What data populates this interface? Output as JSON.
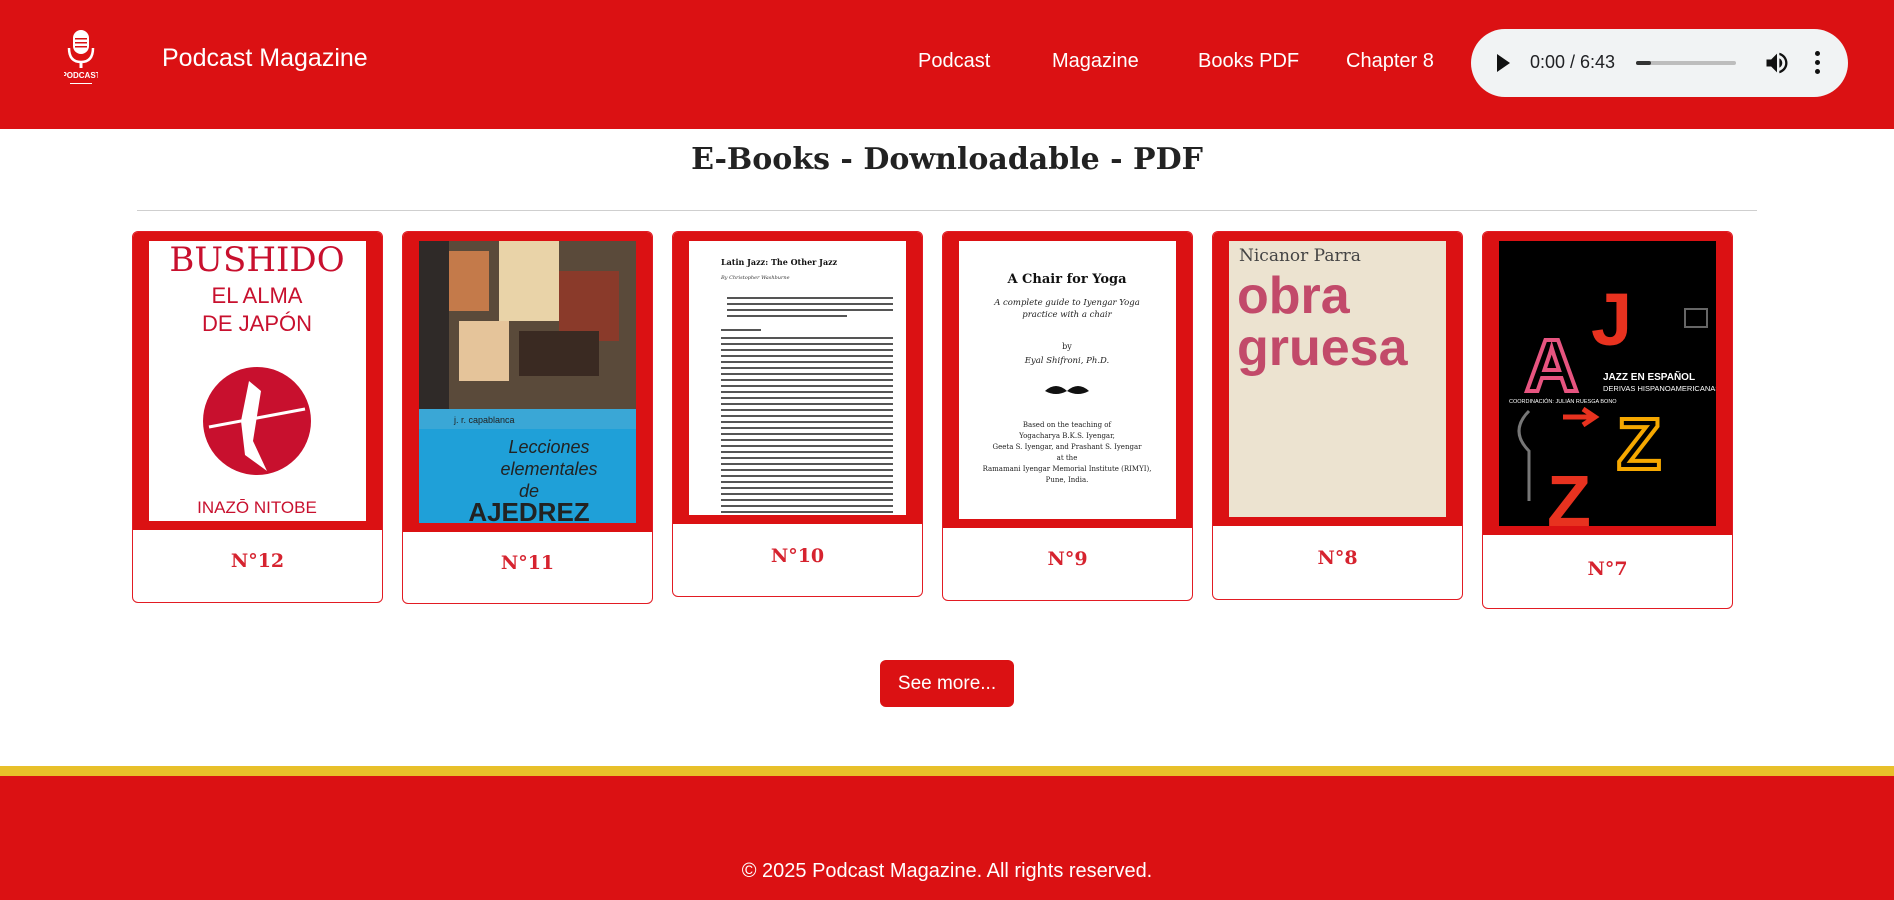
{
  "header": {
    "brand": "Podcast Magazine",
    "logo_text": "PODCAST",
    "nav": [
      "Podcast",
      "Magazine",
      "Books PDF",
      "Chapter 8"
    ],
    "audio": {
      "time": "0:00 / 6:43",
      "progress": 0.15
    }
  },
  "main": {
    "title": "E-Books - Downloadable - PDF",
    "books": [
      {
        "issue": "N°12",
        "cover_title": "BUSHIDO",
        "cover_subtitle": "EL ALMA DE JAPÓN",
        "author": "INAZŌ NITOBE"
      },
      {
        "issue": "N°11",
        "cover_title": "Lecciones elementales de AJEDREZ",
        "author": "j. r. capablanca"
      },
      {
        "issue": "N°10",
        "cover_title": "Latin Jazz: The Other Jazz",
        "author": "By Christopher Washburne"
      },
      {
        "issue": "N°9",
        "cover_title": "A Chair for Yoga",
        "cover_subtitle": "A complete guide to Iyengar Yoga practice with a chair",
        "author": "Eyal Shifroni, Ph.D."
      },
      {
        "issue": "N°8",
        "cover_title": "obra gruesa",
        "author": "Nicanor Parra"
      },
      {
        "issue": "N°7",
        "cover_title": "JAZZ EN ESPAÑOL",
        "cover_subtitle": "DERIVAS HISPANOAMERICANAS",
        "author": "JULIÁN RUESGA BONO"
      }
    ],
    "see_more": "See more..."
  },
  "footer": {
    "copyright": "© 2025 Podcast Magazine. All rights reserved."
  },
  "colors": {
    "brand_red": "#db1113",
    "accent_yellow": "#e8c02a",
    "issue_red": "#d6232f"
  }
}
